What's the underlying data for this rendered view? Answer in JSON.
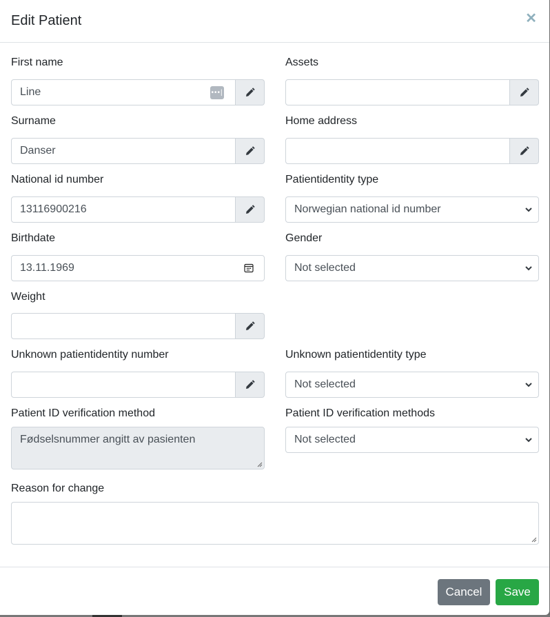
{
  "modal": {
    "title": "Edit Patient",
    "close_icon": "close-icon (×)"
  },
  "fields": {
    "first_name": {
      "label": "First name",
      "value": "Line",
      "icon": "password-manager-icon",
      "addon_icon": "pencil-icon"
    },
    "assets": {
      "label": "Assets",
      "value": "",
      "addon_icon": "pencil-icon"
    },
    "surname": {
      "label": "Surname",
      "value": "Danser",
      "addon_icon": "pencil-icon"
    },
    "home_address": {
      "label": "Home address",
      "value": "",
      "addon_icon": "pencil-icon"
    },
    "national_id": {
      "label": "National id number",
      "value": "13116900216",
      "addon_icon": "pencil-icon"
    },
    "identity_type": {
      "label": "Patientidentity type",
      "selected": "Norwegian national id number"
    },
    "birthdate": {
      "label": "Birthdate",
      "value": "13.11.1969",
      "icon": "calendar-icon"
    },
    "gender": {
      "label": "Gender",
      "selected": "Not selected"
    },
    "weight": {
      "label": "Weight",
      "value": "",
      "addon_icon": "pencil-icon"
    },
    "unknown_id_number": {
      "label": "Unknown patientidentity number",
      "value": "",
      "addon_icon": "pencil-icon"
    },
    "unknown_id_type": {
      "label": "Unknown patientidentity type",
      "selected": "Not selected"
    },
    "verification_method": {
      "label": "Patient ID verification method",
      "value": "Fødselsnummer angitt av pasienten"
    },
    "verification_methods": {
      "label": "Patient ID verification methods",
      "selected": "Not selected"
    },
    "reason": {
      "label": "Reason for change",
      "value": ""
    }
  },
  "footer": {
    "cancel_label": "Cancel",
    "save_label": "Save"
  },
  "colors": {
    "save": "#28a745",
    "cancel": "#6c757d",
    "addon_bg": "#e9ecef",
    "readonly_bg": "#e9ecef"
  }
}
